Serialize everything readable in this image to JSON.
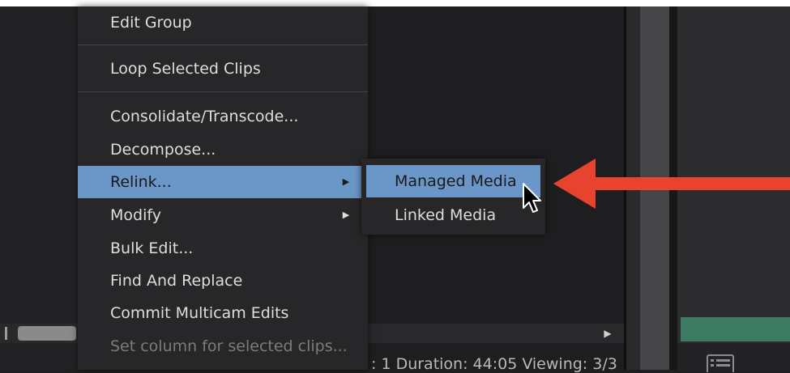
{
  "context_menu": {
    "items": [
      {
        "label": "Edit Group",
        "state": "normal"
      },
      {
        "label": "Loop Selected Clips",
        "state": "normal"
      },
      {
        "label": "Consolidate/Transcode...",
        "state": "normal"
      },
      {
        "label": "Decompose...",
        "state": "normal"
      },
      {
        "label": "Relink...",
        "state": "highlighted",
        "has_submenu": true
      },
      {
        "label": "Modify",
        "state": "normal",
        "has_submenu": true
      },
      {
        "label": "Bulk Edit...",
        "state": "normal"
      },
      {
        "label": "Find And Replace",
        "state": "normal"
      },
      {
        "label": "Commit Multicam Edits",
        "state": "normal"
      },
      {
        "label": "Set column for selected clips...",
        "state": "disabled"
      }
    ],
    "submenu_arrow_glyph": "▶"
  },
  "relink_submenu": {
    "items": [
      {
        "label": "Managed Media",
        "state": "highlighted"
      },
      {
        "label": "Linked Media",
        "state": "normal"
      }
    ]
  },
  "status_bar": {
    "text": ": 1 Duration: 44:05  Viewing: 3/3"
  },
  "scrollbar": {
    "right_arrow_glyph": "▶"
  },
  "icons": {
    "cursor": "mouse-pointer-icon",
    "annotation": "red-arrow-pointing-left",
    "list_view": "list-view-icon"
  },
  "colors": {
    "menu_background": "#272729",
    "highlight": "#6a96c8",
    "annotation_arrow": "#e8432e",
    "green_bar": "#3c7a62"
  }
}
